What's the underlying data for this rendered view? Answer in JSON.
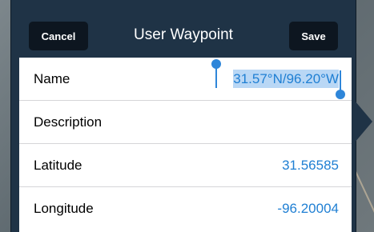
{
  "header": {
    "title": "User Waypoint",
    "cancel_label": "Cancel",
    "save_label": "Save"
  },
  "fields": [
    {
      "label": "Name",
      "value": "31.57°N/96.20°W"
    },
    {
      "label": "Description",
      "value": ""
    },
    {
      "label": "Latitude",
      "value": "31.56585"
    },
    {
      "label": "Longitude",
      "value": "-96.20004"
    }
  ],
  "colors": {
    "header_bg": "#1f3346",
    "button_bg": "#0d1620",
    "value_blue": "#1f7fd3",
    "selection": "#b9d7f5"
  }
}
